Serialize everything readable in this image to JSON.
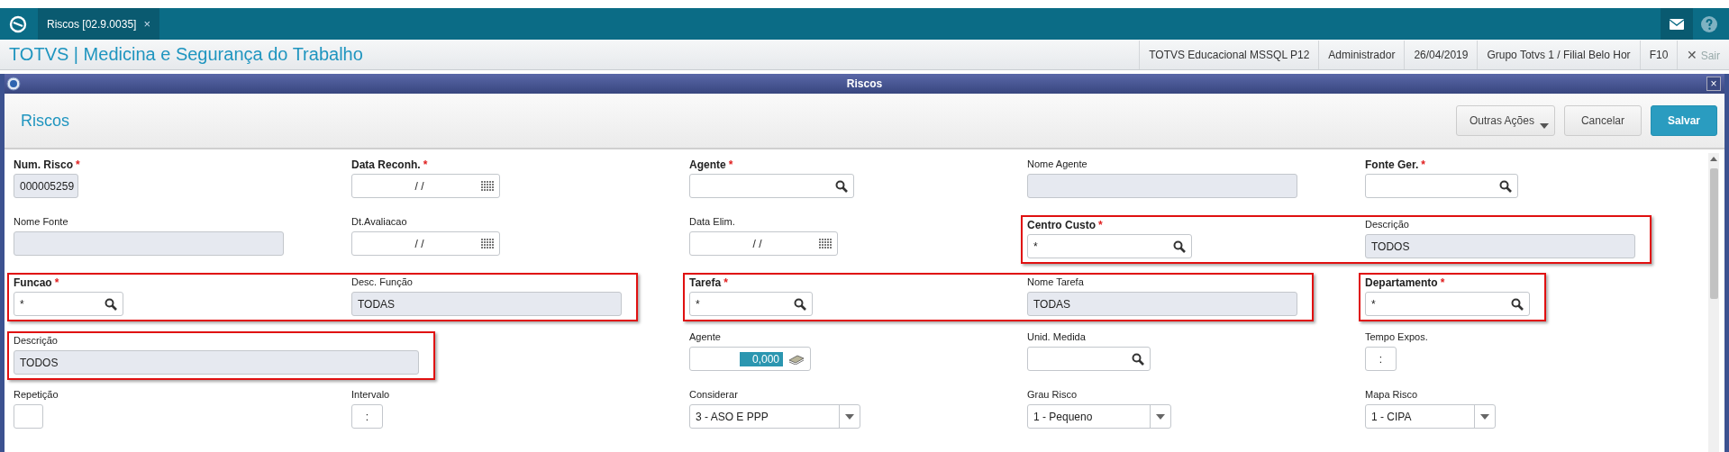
{
  "top_bar": {
    "tab": {
      "label": "Riscos [02.9.0035]",
      "close": "×",
      "selected": true
    }
  },
  "header": {
    "title": "TOTVS | Medicina e Segurança do Trabalho",
    "info": [
      "TOTVS Educacional MSSQL P12",
      "Administrador",
      "26/04/2019",
      "Grupo Totvs 1 / Filial Belo Hor",
      "F10"
    ],
    "exit": {
      "icon": "✕",
      "label": "Sair",
      "disabled": true
    }
  },
  "dialog": {
    "title": "Riscos",
    "close": "×"
  },
  "panel": {
    "title": "Riscos",
    "buttons": [
      {
        "label": "Outras Ações",
        "kind": "menu"
      },
      {
        "label": "Cancelar",
        "kind": "default"
      },
      {
        "label": "Salvar",
        "kind": "primary"
      }
    ]
  },
  "rows": [
    {
      "groups": [
        {
          "fields": [
            {
              "label": "Num. Risco",
              "required": true,
              "required_mark": "*",
              "kind": "readonly",
              "value": "000005259"
            },
            {
              "label": "Data Reconh.",
              "required": true,
              "required_mark": "*",
              "kind": "date",
              "value": "/ /"
            },
            {
              "label": "Agente",
              "required": true,
              "required_mark": "*",
              "kind": "lookup"
            },
            {
              "label": "Nome Agente",
              "required": false,
              "kind": "readonly"
            },
            {
              "label": "Fonte Ger.",
              "required": true,
              "required_mark": "*",
              "kind": "lookup"
            }
          ]
        }
      ]
    },
    {
      "groups": [
        {
          "fields": [
            {
              "label": "Nome Fonte",
              "required": false,
              "kind": "readonly"
            },
            {
              "label": "Dt.Avaliacao",
              "required": false,
              "kind": "date",
              "value": "/ /"
            },
            {
              "label": "Data Elim.",
              "required": false,
              "kind": "date",
              "value": "/ /"
            }
          ]
        },
        {
          "outlined": true,
          "fields": [
            {
              "label": "Centro Custo",
              "required": true,
              "required_mark": "*",
              "kind": "lookup",
              "value": "*"
            },
            {
              "label": "Descrição",
              "required": false,
              "kind": "readonly",
              "value": "TODOS"
            }
          ]
        }
      ]
    },
    {
      "groups": [
        {
          "outlined": true,
          "fields": [
            {
              "label": "Funcao",
              "required": true,
              "required_mark": "*",
              "kind": "lookup",
              "value": "*"
            },
            {
              "label": "Desc. Função",
              "required": false,
              "kind": "readonly",
              "value": "TODAS"
            }
          ]
        },
        {
          "outlined": true,
          "fields": [
            {
              "label": "Tarefa",
              "required": true,
              "required_mark": "*",
              "kind": "lookup",
              "value": "*"
            },
            {
              "label": "Nome Tarefa",
              "required": false,
              "kind": "readonly",
              "value": "TODAS"
            }
          ]
        },
        {
          "outlined": true,
          "fields": [
            {
              "label": "Departamento",
              "required": true,
              "required_mark": "*",
              "kind": "lookup",
              "value": "*"
            }
          ]
        }
      ]
    },
    {
      "groups": [
        {
          "outlined": true,
          "fields": [
            {
              "label": "Descrição",
              "required": false,
              "kind": "readonly",
              "value": "TODOS"
            }
          ]
        },
        {
          "fields": [
            {
              "label": "Agente",
              "required": false,
              "kind": "number",
              "value": "0,000"
            },
            {
              "label": "Unid. Medida",
              "required": false,
              "kind": "lookup"
            },
            {
              "label": "Tempo Expos.",
              "required": false,
              "kind": "text",
              "value": ":"
            }
          ]
        }
      ]
    },
    {
      "groups": [
        {
          "fields": [
            {
              "label": "Repetição",
              "required": false,
              "kind": "text"
            },
            {
              "label": "Intervalo",
              "required": false,
              "kind": "text",
              "value": ":"
            },
            {
              "label": "Considerar",
              "required": false,
              "kind": "select",
              "value": "3 - ASO E PPP"
            },
            {
              "label": "Grau Risco",
              "required": false,
              "kind": "select",
              "value": "1 - Pequeno"
            },
            {
              "label": "Mapa Risco",
              "required": false,
              "kind": "select",
              "value": "1 - CIPA"
            }
          ]
        }
      ]
    }
  ]
}
